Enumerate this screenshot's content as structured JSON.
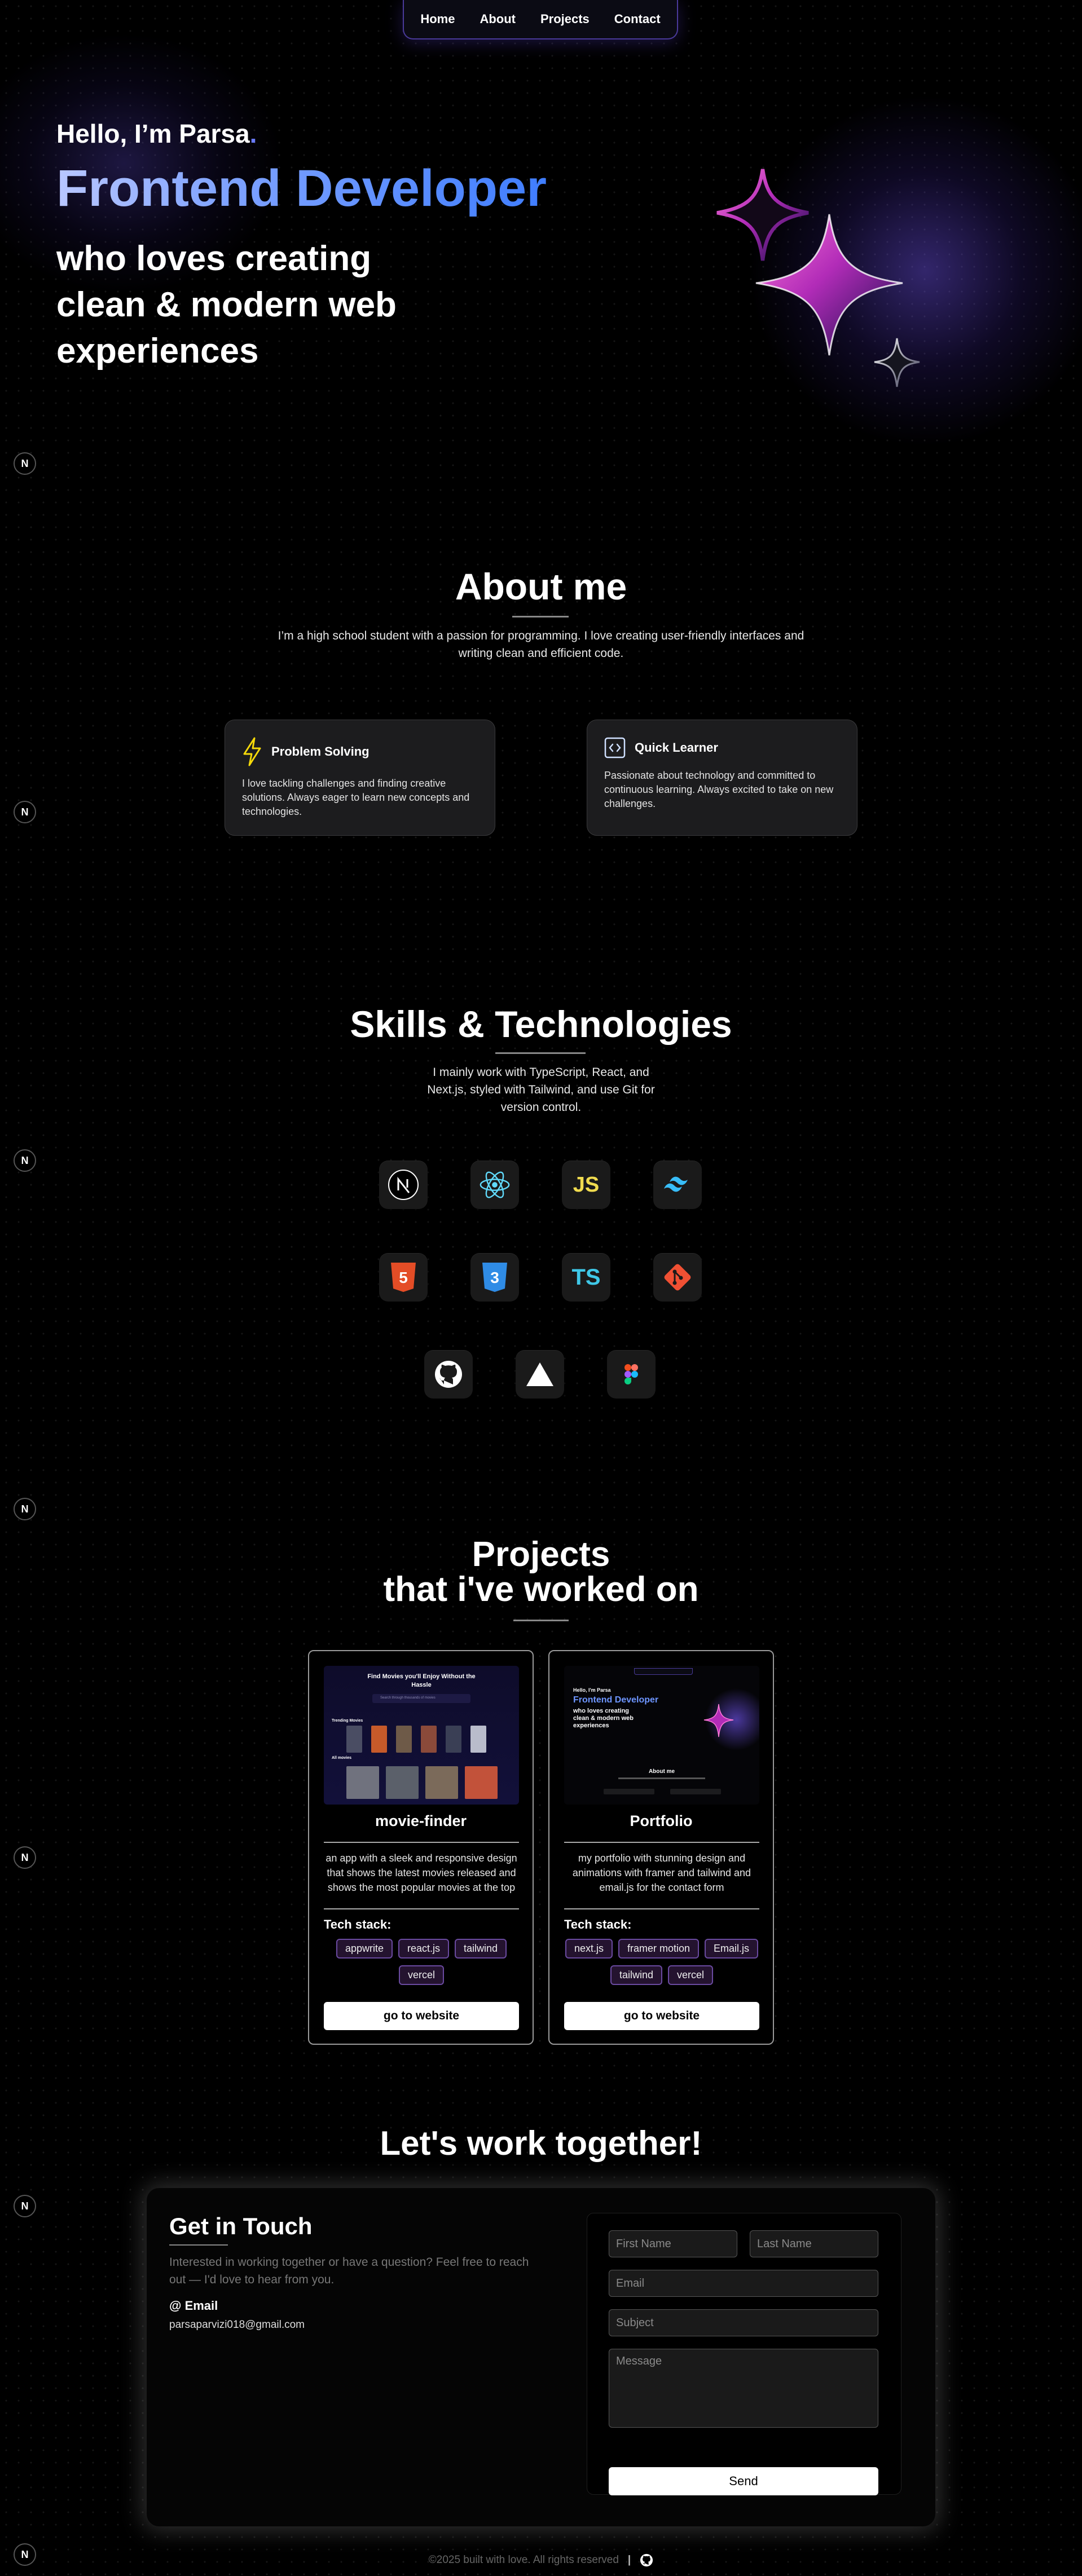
{
  "nav": {
    "items": [
      "Home",
      "About",
      "Projects",
      "Contact"
    ]
  },
  "badge": {
    "letter": "N"
  },
  "hero": {
    "hello": "Hello, I’m Parsa",
    "hello_dot": ".",
    "role": "Frontend Developer",
    "subtitle": "who loves creating clean & modern web experiences"
  },
  "about": {
    "title": "About me",
    "text": "I’m a high school student with a passion for programming. I love creating user-friendly interfaces and writing clean and efficient code.",
    "cards": [
      {
        "icon": "lightning-icon",
        "title": "Problem Solving",
        "body": "I love tackling challenges and finding creative solutions. Always eager to learn new concepts and technologies."
      },
      {
        "icon": "code-brackets-icon",
        "title": "Quick Learner",
        "body": "Passionate about technology and committed to continuous learning. Always excited to take on new challenges."
      }
    ]
  },
  "skills": {
    "title": "Skills & Technologies",
    "text": "I mainly work with TypeScript, React, and Next.js, styled with Tailwind, and use Git for version control.",
    "icons": [
      "nextjs-icon",
      "react-icon",
      "javascript-icon",
      "tailwind-icon",
      "html5-icon",
      "css3-icon",
      "typescript-icon",
      "git-icon",
      "github-icon",
      "vercel-icon",
      "figma-icon"
    ],
    "glyphs": {
      "js": "JS",
      "ts": "TS",
      "html": "5",
      "css": "3"
    }
  },
  "projects": {
    "title_line1": "Projects",
    "title_line2": "that i've worked on",
    "stack_label": "Tech stack:",
    "button": "go to website",
    "items": [
      {
        "name": "movie-finder",
        "desc": "an app with a sleek and responsive design that shows the latest movies released and shows the most popular movies at the top",
        "tags": [
          "appwrite",
          "react.js",
          "tailwind",
          "vercel"
        ],
        "shot": {
          "heading": "Find Movies you'll Enjoy Without the Hassle",
          "trending": "Trending Movies",
          "all": "All movies",
          "search": "Search through thousands of movies"
        }
      },
      {
        "name": "Portfolio",
        "desc": "my portfolio with stunning design and animations with framer and tailwind and email.js for the contact form",
        "tags": [
          "next.js",
          "framer motion",
          "Email.js",
          "tailwind",
          "vercel"
        ],
        "shot": {
          "hello": "Hello, I'm Parsa",
          "role": "Frontend Developer",
          "sub": "who loves creating clean & modern web experiences",
          "about": "About me"
        }
      }
    ]
  },
  "contact": {
    "section_title": "Let's work together!",
    "title": "Get in Touch",
    "text": "Interested in working together or have a question? Feel free to reach out — I'd love to hear from you.",
    "email_label": "@ Email",
    "email": "parsaparvizi018@gmail.com",
    "placeholders": {
      "first": "First Name",
      "last": "Last Name",
      "email": "Email",
      "subject": "Subject",
      "message": "Message"
    },
    "send": "Send"
  },
  "footer": {
    "text": "©2025 built with love. All rights reserved",
    "sep": "|"
  }
}
